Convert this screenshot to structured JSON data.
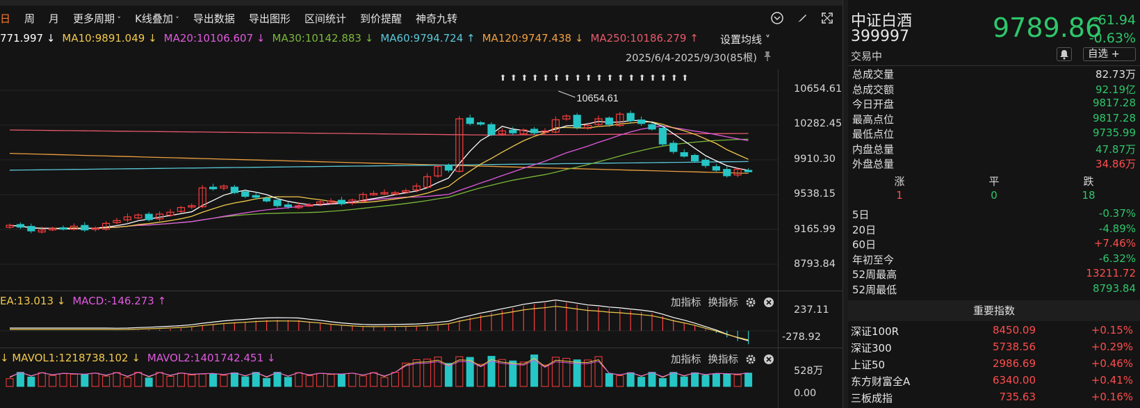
{
  "toolbar": {
    "items": [
      "日",
      "周",
      "月",
      "更多周期",
      "K线叠加",
      "导出数据",
      "导出图形",
      "区间统计",
      "到价提醒",
      "神奇九转"
    ]
  },
  "ma": {
    "ma5": "771.997",
    "ma10": "MA10:9891.049",
    "ma20": "MA20:10106.607",
    "ma30": "MA30:10142.883",
    "ma60": "MA60:9794.724",
    "ma120": "MA120:9747.438",
    "ma250": "MA250:10186.279",
    "arrow_down": "↓",
    "arrow_up": "↑",
    "settings_label": "设置均线",
    "colors": {
      "ma5": "#ffffff",
      "ma10": "#f2c94c",
      "ma20": "#e05ae0",
      "ma30": "#7ab83a",
      "ma60": "#5ac8d8",
      "ma120": "#f0a040",
      "ma250": "#e85a6a"
    }
  },
  "range_label": "2025/6/4-2025/9/30(85根)",
  "high_marker": "10654.61",
  "yaxis": {
    "main": [
      "10654.61",
      "10282.45",
      "9910.30",
      "9538.15",
      "9165.99",
      "8793.84"
    ],
    "macd": [
      "237.11",
      "-278.92"
    ],
    "vol": [
      "528万",
      "0.00"
    ]
  },
  "macd_header": {
    "dea": "EA:13.013",
    "macd": "MACD:-146.273",
    "add": "加指标",
    "swap": "换指标"
  },
  "vol_header": {
    "mavol1": "MAVOL1:1218738.102",
    "mavol2": "MAVOL2:1401742.451"
  },
  "chart_data": {
    "type": "candlestick",
    "ylim": [
      8793.84,
      10654.61
    ],
    "closes": [
      9210,
      9190,
      9150,
      9160,
      9175,
      9180,
      9200,
      9160,
      9180,
      9230,
      9260,
      9300,
      9320,
      9270,
      9330,
      9350,
      9400,
      9420,
      9610,
      9600,
      9630,
      9560,
      9520,
      9510,
      9470,
      9420,
      9410,
      9420,
      9430,
      9460,
      9470,
      9440,
      9480,
      9540,
      9550,
      9560,
      9560,
      9580,
      9630,
      9730,
      9840,
      9800,
      10350,
      10300,
      10300,
      10180,
      10220,
      10200,
      10230,
      10200,
      10220,
      10340,
      10380,
      10260,
      10280,
      10350,
      10290,
      10400,
      10330,
      10300,
      10240,
      10080,
      10000,
      9950,
      9900,
      9850,
      9800,
      9740,
      9810,
      9790
    ],
    "up_color": "#ff3d3d",
    "down_color": "#26c6c6"
  },
  "right": {
    "name": "中证白酒",
    "code": "399997",
    "price": "9789.86",
    "chg": "-61.94",
    "chg_pct": "-0.63%",
    "status": "交易中",
    "zixuan": "自选 +",
    "stats": [
      {
        "k": "总成交量",
        "v": "82.73万",
        "c": "w"
      },
      {
        "k": "总成交额",
        "v": "92.19亿",
        "c": "g"
      },
      {
        "k": "今日开盘",
        "v": "9817.28",
        "c": "g"
      },
      {
        "k": "最高点位",
        "v": "9817.28",
        "c": "g"
      },
      {
        "k": "最低点位",
        "v": "9735.99",
        "c": "g"
      },
      {
        "k": "内盘总量",
        "v": "47.87万",
        "c": "g"
      },
      {
        "k": "外盘总量",
        "v": "34.86万",
        "c": "r"
      }
    ],
    "adv": {
      "labels": [
        "涨",
        "平",
        "跌"
      ],
      "values": [
        "1",
        "0",
        "18"
      ]
    },
    "perf": [
      {
        "k": "5日",
        "v": "-0.37%",
        "c": "g"
      },
      {
        "k": "20日",
        "v": "-4.89%",
        "c": "g"
      },
      {
        "k": "60日",
        "v": "+7.46%",
        "c": "r"
      },
      {
        "k": "年初至今",
        "v": "-6.32%",
        "c": "g"
      },
      {
        "k": "52周最高",
        "v": "13211.72",
        "c": "r"
      },
      {
        "k": "52周最低",
        "v": "8793.84",
        "c": "g"
      }
    ],
    "important_title": "重要指数",
    "indices": [
      {
        "n": "深证100R",
        "p": "8450.09",
        "c": "+0.15%"
      },
      {
        "n": "深证300",
        "p": "5738.56",
        "c": "+0.29%"
      },
      {
        "n": "上证50",
        "p": "2986.69",
        "c": "+0.46%"
      },
      {
        "n": "东方财富全A",
        "p": "6340.00",
        "c": "+0.41%"
      },
      {
        "n": "三板成指",
        "p": "735.63",
        "c": "+0.16%"
      }
    ]
  }
}
